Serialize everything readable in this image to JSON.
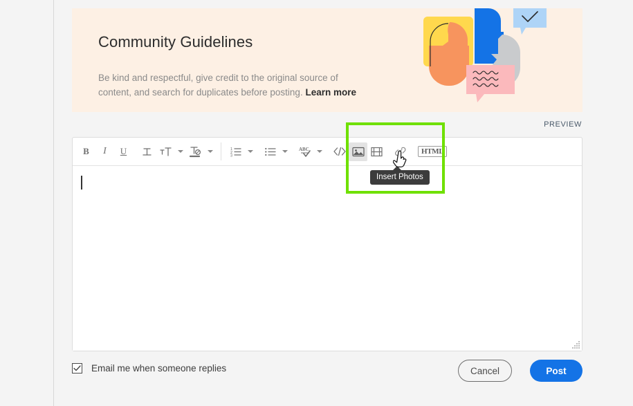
{
  "banner": {
    "title": "Community Guidelines",
    "body_line1": "Be kind and respectful, give credit to the original source of",
    "body_line2": "content, and search for duplicates before posting.",
    "link_label": "Learn more",
    "bg_color": "#fdf0e4"
  },
  "preview": {
    "label": "PREVIEW"
  },
  "toolbar": {
    "items": [
      {
        "name": "bold",
        "glyph": "B",
        "tooltip": "Bold"
      },
      {
        "name": "italic",
        "glyph": "I",
        "tooltip": "Italic"
      },
      {
        "name": "underline",
        "glyph": "U",
        "tooltip": "Underline"
      },
      {
        "name": "strikethrough",
        "glyph": "T",
        "tooltip": "Strikethrough"
      },
      {
        "name": "font-size",
        "glyph": "T",
        "tooltip": "Font Size"
      },
      {
        "name": "text-color",
        "glyph": "T",
        "tooltip": "Text Color"
      },
      {
        "name": "numbered-list",
        "glyph": "",
        "tooltip": "Numbered List"
      },
      {
        "name": "bullet-list",
        "glyph": "",
        "tooltip": "Bulleted List"
      },
      {
        "name": "spell-check",
        "glyph": "ABC",
        "tooltip": "Spell Check"
      },
      {
        "name": "insert-code",
        "glyph": "</>",
        "tooltip": "Insert Code"
      },
      {
        "name": "insert-photos",
        "glyph": "",
        "tooltip": "Insert Photos"
      },
      {
        "name": "insert-video",
        "glyph": "",
        "tooltip": "Insert Video"
      },
      {
        "name": "insert-link",
        "glyph": "",
        "tooltip": "Insert Link"
      }
    ],
    "html_button_label": "HTML",
    "active_item": "insert-photos",
    "active_tooltip": "Insert Photos"
  },
  "editor": {
    "content": "",
    "placeholder": ""
  },
  "footer": {
    "checkbox_label": "Email me when someone replies",
    "checkbox_checked": true,
    "cancel_label": "Cancel",
    "post_label": "Post",
    "post_color": "#1473e6"
  },
  "annotation": {
    "highlight_color": "#6fe000"
  }
}
